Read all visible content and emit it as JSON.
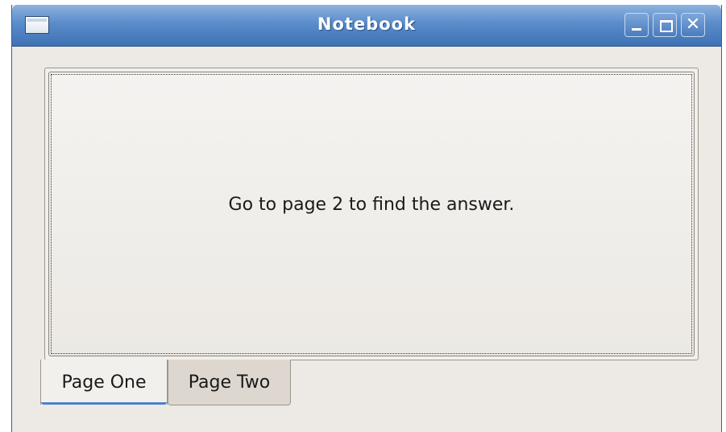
{
  "window": {
    "title": "Notebook"
  },
  "notebook": {
    "tabs": [
      {
        "label": "Page One",
        "selected": true
      },
      {
        "label": "Page Two",
        "selected": false
      }
    ],
    "page_text": "Go to page 2 to find the answer."
  },
  "colors": {
    "titlebar": "#4a7cbd",
    "window_bg": "#edeae5",
    "active_tab_indicator": "#4a83c8"
  }
}
